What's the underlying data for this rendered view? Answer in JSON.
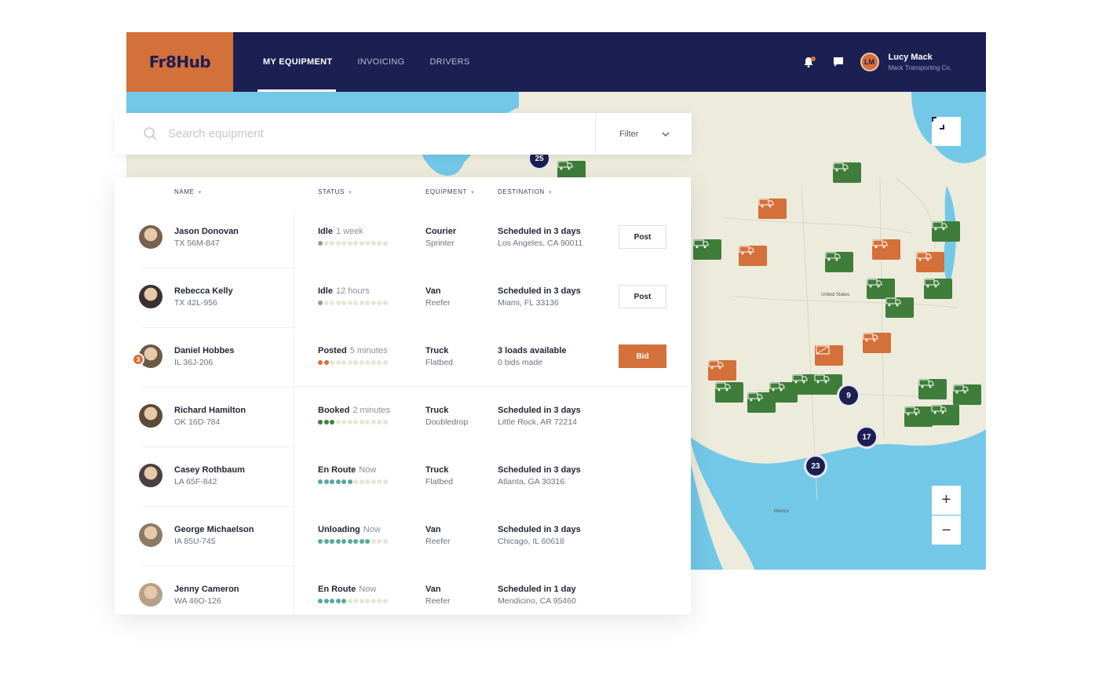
{
  "app": {
    "logo": "Fr8Hub"
  },
  "nav": [
    {
      "label": "MY EQUIPMENT",
      "active": true
    },
    {
      "label": "INVOICING",
      "active": false
    },
    {
      "label": "DRIVERS",
      "active": false
    }
  ],
  "user": {
    "name": "Lucy Mack",
    "company": "Mack Transporting Co.",
    "initials": "LM"
  },
  "search": {
    "placeholder": "Search equipment",
    "filter_label": "Filter"
  },
  "table": {
    "headers": {
      "name": "NAME",
      "status": "STATUS",
      "equipment": "EQUIPMENT",
      "destination": "DESTINATION"
    },
    "rows": [
      {
        "name": "Jason Donovan",
        "plate": "TX 56M-847",
        "status": "Idle",
        "status_time": "1 week",
        "progress": 1,
        "progress_total": 12,
        "equipment": "Courier",
        "equipment_sub": "Sprinter",
        "destination": "Scheduled in 3 days",
        "destination_sub": "Los Angeles, CA 90011",
        "action": "Post"
      },
      {
        "name": "Rebecca Kelly",
        "plate": "TX 42L-956",
        "status": "Idle",
        "status_time": "12 hours",
        "progress": 1,
        "progress_total": 12,
        "equipment": "Van",
        "equipment_sub": "Reefer",
        "destination": "Scheduled in 3 days",
        "destination_sub": "Miami, FL 33136",
        "action": "Post"
      },
      {
        "name": "Daniel Hobbes",
        "plate": "IL 36J-206",
        "badge": "3",
        "status": "Posted",
        "status_time": "5 minutes",
        "progress": 2,
        "progress_total": 12,
        "equipment": "Truck",
        "equipment_sub": "Flatbed",
        "destination": "3 loads available",
        "destination_sub": "0 bids made",
        "action": "Bid"
      },
      {
        "name": "Richard Hamilton",
        "plate": "OK 16D-784",
        "status": "Booked",
        "status_time": "2 minutes",
        "progress": 3,
        "progress_total": 12,
        "equipment": "Truck",
        "equipment_sub": "Doubledrop",
        "destination": "Scheduled in 3 days",
        "destination_sub": "Little Rock, AR 72214",
        "action": ""
      },
      {
        "name": "Casey Rothbaum",
        "plate": "LA 65F-842",
        "status": "En Route",
        "status_time": "Now",
        "progress": 6,
        "progress_total": 12,
        "equipment": "Truck",
        "equipment_sub": "Flatbed",
        "destination": "Scheduled in 3 days",
        "destination_sub": "Atlanta, GA 30316",
        "action": ""
      },
      {
        "name": "George Michaelson",
        "plate": "IA 85U-745",
        "status": "Unloading",
        "status_time": "Now",
        "progress": 9,
        "progress_total": 12,
        "equipment": "Van",
        "equipment_sub": "Reefer",
        "destination": "Scheduled in 3 days",
        "destination_sub": "Chicago, IL 60618",
        "action": ""
      },
      {
        "name": "Jenny Cameron",
        "plate": "WA 46O-126",
        "status": "En Route",
        "status_time": "Now",
        "progress": 5,
        "progress_total": 12,
        "equipment": "Van",
        "equipment_sub": "Reefer",
        "destination": "Scheduled in 1 day",
        "destination_sub": "Mendicino, CA 95460",
        "action": ""
      }
    ]
  },
  "map": {
    "clusters": [
      "25",
      "9",
      "17",
      "23"
    ],
    "labels": [
      "United States",
      "Mexico"
    ],
    "zoom_in": "+",
    "zoom_out": "−"
  },
  "colors": {
    "navy": "#1c1f52",
    "orange": "#d4703a",
    "green": "#3f7d3a",
    "teal": "#5aa7a0",
    "water": "#73c8e8"
  }
}
